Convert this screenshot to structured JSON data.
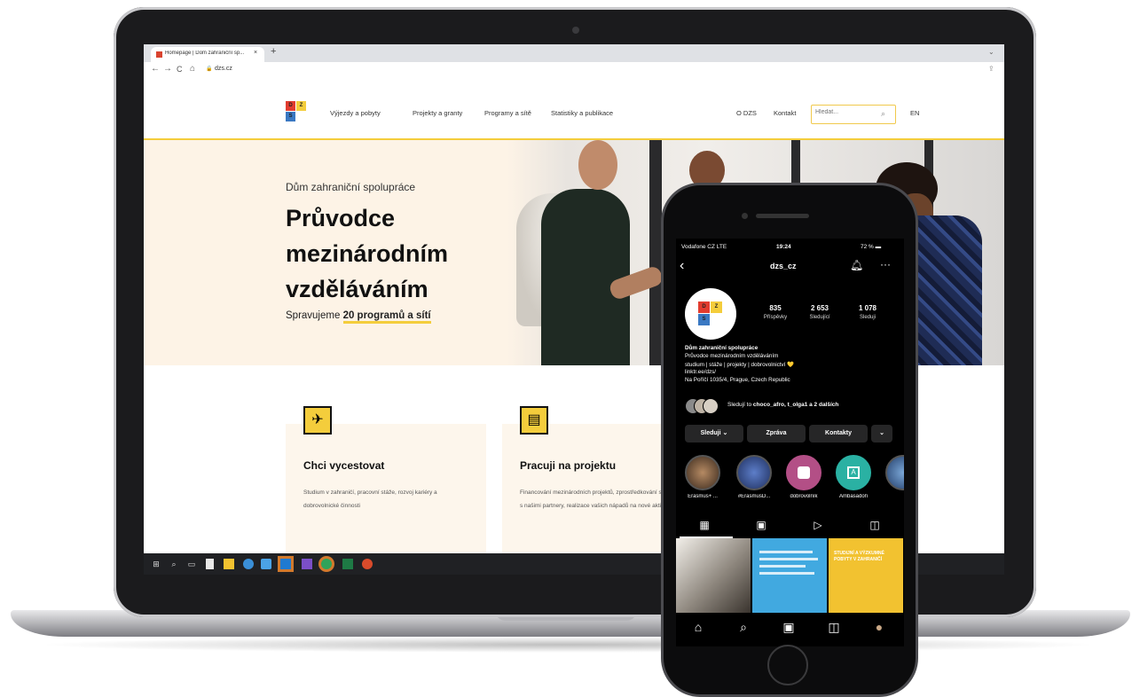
{
  "browser": {
    "tab_title": "Homepage | Dům zahraniční sp...",
    "tab_close": "×",
    "new_tab": "+",
    "url": "dzs.cz",
    "back": "←",
    "forward": "→",
    "reload": "C",
    "home": "⌂"
  },
  "site": {
    "logo_letters": [
      "D",
      "Z",
      "S"
    ],
    "nav": [
      "Výjezdy a pobyty",
      "Projekty a granty",
      "Programy a sítě",
      "Statistiky a publikace"
    ],
    "nav_right": [
      "O DZS",
      "Kontakt"
    ],
    "search_placeholder": "Hledat...",
    "lang": "EN",
    "hero": {
      "kicker": "Dům zahraniční spolupráce",
      "title": "Průvodce mezinárodním vzděláváním",
      "sub_prefix": "Spravujeme ",
      "sub_bold": "20 programů a sítí"
    },
    "cards": [
      {
        "title": "Chci vycestovat",
        "text": "Studium v zahraničí, pracovní stáže, rozvoj kariéry a dobrovolnické činnosti"
      },
      {
        "title": "Pracuji na projektu",
        "text": "Financování mezinárodních projektů, zprostředkování spolupráce s našimi partnery, realizace vašich nápadů na nové aktivity"
      }
    ]
  },
  "phone": {
    "status": {
      "carrier": "Vodafone CZ  LTE",
      "time": "19:24",
      "battery": "72 %"
    },
    "username": "dzs_cz",
    "stats": [
      {
        "num": "835",
        "label": "Příspěvky"
      },
      {
        "num": "2 653",
        "label": "Sledující"
      },
      {
        "num": "1 078",
        "label": "Sleduji"
      }
    ],
    "bio": {
      "name": "Dům zahraniční spolupráce",
      "lines": [
        "Průvodce mezinárodním vzděláváním",
        "studium | stáže | projekty | dobrovolnictví 💛",
        "linktr.ee/dzs/",
        "Na Poříčí 1035/4, Prague, Czech Republic"
      ]
    },
    "followed_by_prefix": "Sledují to ",
    "followed_by_names": "choco_afro, t_olga1 a 2 dalších",
    "buttons": {
      "follow": "Sleduji ⌄",
      "message": "Zpráva",
      "contacts": "Kontakty",
      "more": "⌄"
    },
    "highlights": [
      "Erasmus+ ...",
      "#ErasmusD...",
      "dobrovolník",
      "Ambasadoři",
      ""
    ],
    "posts": [
      {
        "title": "",
        "color": "#cfcbc4"
      },
      {
        "title": "",
        "color": "#41a9e0"
      },
      {
        "title": "STUDIJNÍ A VÝZKUMNÉ POBYTY V ZAHRANIČÍ",
        "color": "#f2c230"
      }
    ],
    "bottom_nav": [
      "⌂",
      "⌕",
      "▣",
      "◫",
      "●"
    ]
  },
  "colors": {
    "accent": "#f4cd3c",
    "logo_red": "#e23c2f",
    "logo_blue": "#3a78c2"
  }
}
